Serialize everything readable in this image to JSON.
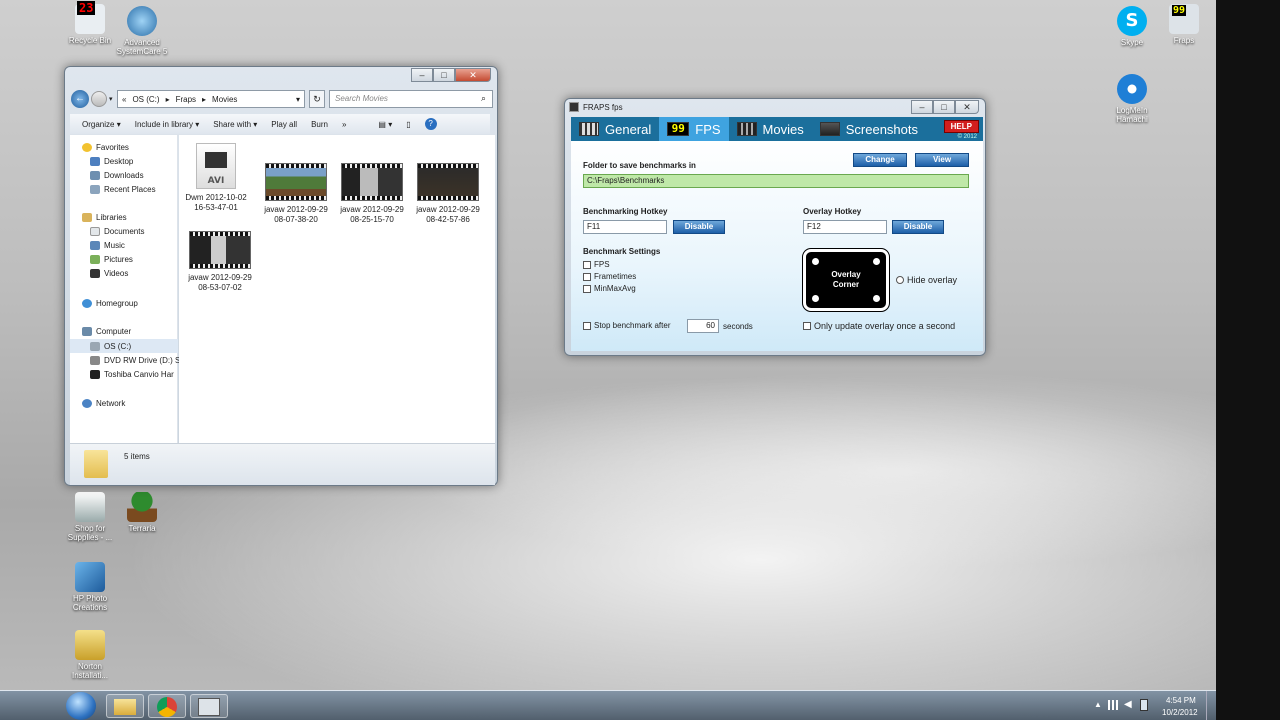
{
  "desktop": {
    "icons": [
      {
        "label": "Recycle Bin",
        "icon": "recycle-bin-icon",
        "badge": "23"
      },
      {
        "label": "Advanced SystemCare 5",
        "icon": "systemcare-icon"
      },
      {
        "label": "Skype",
        "icon": "skype-icon"
      },
      {
        "label": "Fraps",
        "icon": "fraps-icon",
        "badge": "99"
      },
      {
        "label": "LogMeIn Hamachi",
        "icon": "hamachi-icon"
      },
      {
        "label": "Shop for Supplies - ...",
        "icon": "printer-icon"
      },
      {
        "label": "Terraria",
        "icon": "terraria-icon"
      },
      {
        "label": "HP Photo Creations",
        "icon": "hp-photo-icon"
      },
      {
        "label": "Norton Installati...",
        "icon": "norton-icon"
      }
    ]
  },
  "explorer": {
    "breadcrumb": [
      "OS (C:)",
      "Fraps",
      "Movies"
    ],
    "search_placeholder": "Search Movies",
    "toolbar": [
      "Organize",
      "Include in library",
      "Share with",
      "Play all",
      "Burn"
    ],
    "nav": {
      "favorites": "Favorites",
      "favorites_items": [
        "Desktop",
        "Downloads",
        "Recent Places"
      ],
      "libraries": "Libraries",
      "libraries_items": [
        "Documents",
        "Music",
        "Pictures",
        "Videos"
      ],
      "homegroup": "Homegroup",
      "computer": "Computer",
      "computer_items": [
        "OS (C:)",
        "DVD RW Drive (D:) S",
        "Toshiba Canvio Har"
      ],
      "network": "Network"
    },
    "files": [
      {
        "name": "Dwm 2012-10-02 16-53-47-01",
        "badge": "AVI"
      },
      {
        "name": "javaw 2012-09-29 08-07-38-20"
      },
      {
        "name": "javaw 2012-09-29 08-25-15-70"
      },
      {
        "name": "javaw 2012-09-29 08-42-57-86"
      },
      {
        "name": "javaw 2012-09-29 08-53-07-02"
      }
    ],
    "status": "5 items"
  },
  "fraps": {
    "title": "FRAPS fps",
    "tabs": [
      {
        "label": "General",
        "icon": "grid-icon"
      },
      {
        "label": "FPS",
        "icon": "fps-99-icon",
        "badge": "99"
      },
      {
        "label": "Movies",
        "icon": "film-icon"
      },
      {
        "label": "Screenshots",
        "icon": "camera-icon"
      }
    ],
    "help": "HELP",
    "copyright": "© 2012",
    "folder_label": "Folder to save benchmarks in",
    "folder_value": "C:\\Fraps\\Benchmarks",
    "change": "Change",
    "view": "View",
    "bench_hotkey_label": "Benchmarking Hotkey",
    "bench_hotkey_value": "F11",
    "overlay_hotkey_label": "Overlay Hotkey",
    "overlay_hotkey_value": "F12",
    "disable": "Disable",
    "settings_label": "Benchmark Settings",
    "settings": [
      "FPS",
      "Frametimes",
      "MinMaxAvg"
    ],
    "stop_label": "Stop benchmark after",
    "stop_value": "60",
    "stop_unit": "seconds",
    "overlay_corner": "Overlay Corner",
    "hide_overlay": "Hide overlay",
    "only_update": "Only update overlay once a second"
  },
  "taskbar": {
    "time": "4:54 PM",
    "date": "10/2/2012",
    "apps": [
      "explorer-icon",
      "chrome-icon",
      "fraps-icon"
    ]
  }
}
